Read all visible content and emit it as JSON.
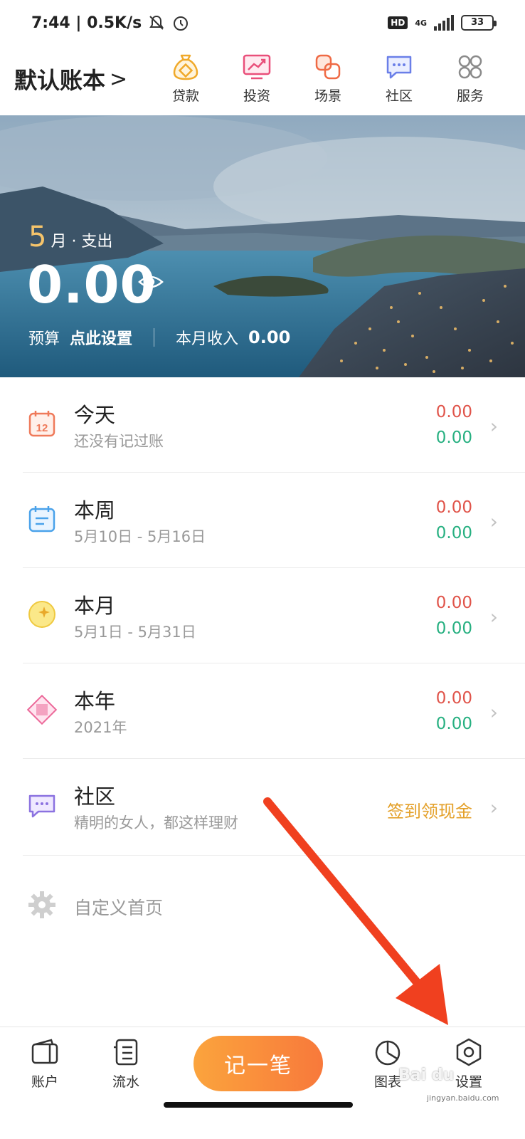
{
  "status_bar": {
    "time_speed": "7:44 | 0.5K/s",
    "hd": "HD",
    "network": "4G",
    "battery": "33"
  },
  "top_nav": {
    "book_title": "默认账本",
    "book_chevron": ">",
    "items": [
      {
        "label": "贷款",
        "icon": "money-bag-icon"
      },
      {
        "label": "投资",
        "icon": "investment-chart-icon"
      },
      {
        "label": "场景",
        "icon": "scene-icon"
      },
      {
        "label": "社区",
        "icon": "chat-bubble-icon"
      },
      {
        "label": "服务",
        "icon": "grid-icon"
      }
    ]
  },
  "hero": {
    "month_num": "5",
    "month_label": "月 · 支出",
    "amount": "0.00",
    "budget_label": "预算",
    "budget_value": "点此设置",
    "income_label": "本月收入",
    "income_value": "0.00"
  },
  "list": [
    {
      "title": "今天",
      "subtitle": "还没有记过账",
      "expense": "0.00",
      "income": "0.00",
      "icon": "calendar-12-icon"
    },
    {
      "title": "本周",
      "subtitle": "5月10日 - 5月16日",
      "expense": "0.00",
      "income": "0.00",
      "icon": "calendar-week-icon"
    },
    {
      "title": "本月",
      "subtitle": "5月1日 - 5月31日",
      "expense": "0.00",
      "income": "0.00",
      "icon": "moon-icon"
    },
    {
      "title": "本年",
      "subtitle": "2021年",
      "expense": "0.00",
      "income": "0.00",
      "icon": "diamond-icon"
    }
  ],
  "community": {
    "title": "社区",
    "subtitle": "精明的女人，都这样理财",
    "action": "签到领现金"
  },
  "customize": {
    "label": "自定义首页"
  },
  "tab_bar": {
    "account": "账户",
    "flow": "流水",
    "record": "记一笔",
    "chart": "图表",
    "settings": "设置"
  },
  "watermark": {
    "brand": "Bai du",
    "url": "jingyan.baidu.com"
  },
  "colors": {
    "expense_red": "#e0544a",
    "income_green": "#27b081",
    "accent_orange": "#f8793b",
    "gold": "#e4a12b",
    "annotation_arrow": "#f0401f"
  }
}
